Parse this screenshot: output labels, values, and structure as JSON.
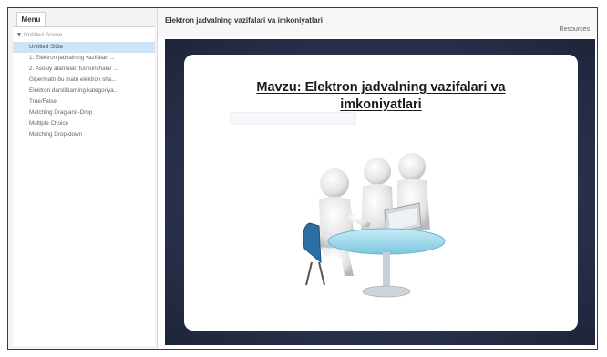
{
  "sidebar": {
    "tab_label": "Menu",
    "scene_label": "Untitled Scene",
    "items": [
      {
        "label": "Untitled Slide",
        "active": true
      },
      {
        "label": "1. Elektron jadvalning vazifalari ...",
        "active": false
      },
      {
        "label": "2. Asosiy atamalar, tushunchalar ...",
        "active": false
      },
      {
        "label": "Gipermatn-bu matn elektron sha...",
        "active": false
      },
      {
        "label": "Elektron darsliklarning kategoriya...",
        "active": false
      },
      {
        "label": "True/False",
        "active": false
      },
      {
        "label": "Matching Drag-and-Drop",
        "active": false
      },
      {
        "label": "Multiple Choice",
        "active": false
      },
      {
        "label": "Matching Drop-down",
        "active": false
      }
    ]
  },
  "header": {
    "title": "Elektron jadvalning vazifalari va imkoniyatlari",
    "resources_label": "Resources"
  },
  "slide": {
    "title": "Mavzu: Elektron jadvalning vazifalari va imkoniyatlari"
  },
  "colors": {
    "active_item": "#cfe4f7",
    "stage_background": "#2c3350",
    "table": "#9fd6e8"
  }
}
